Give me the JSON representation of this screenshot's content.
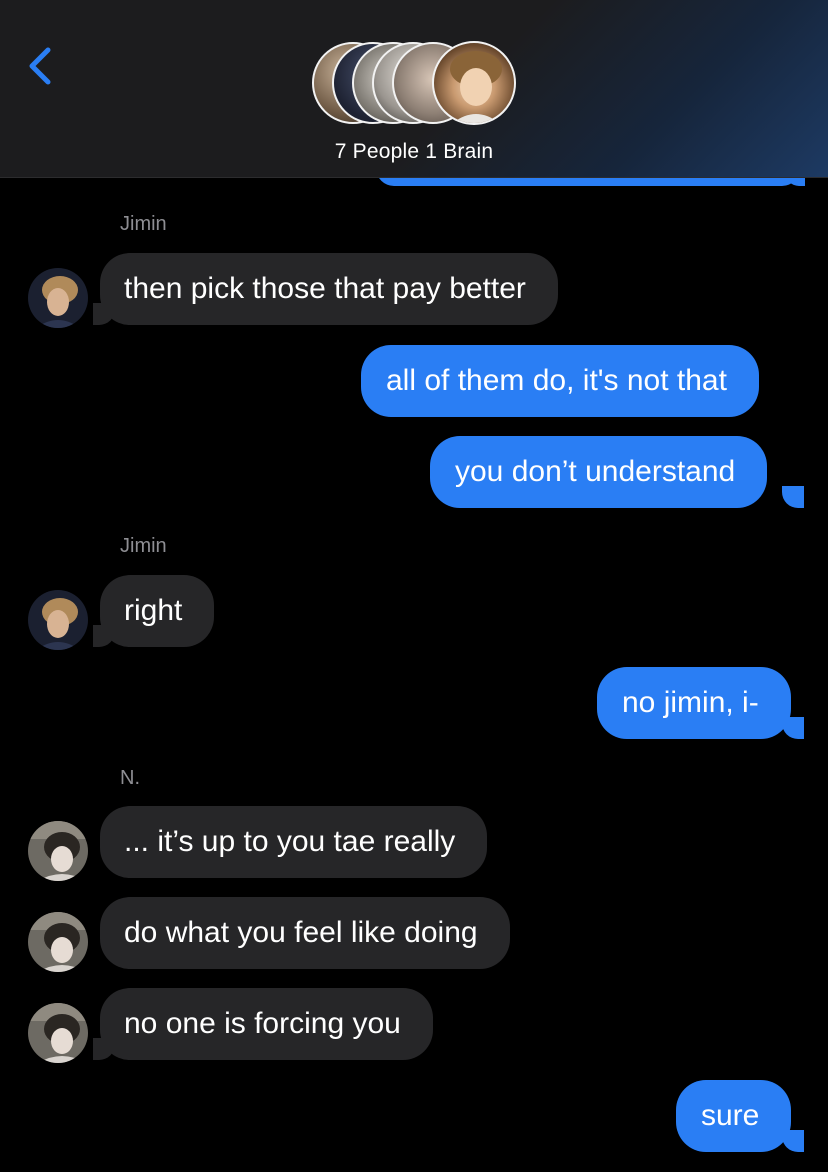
{
  "header": {
    "group_name": "7 People 1 Brain"
  },
  "messages": [
    {
      "sender": "Jimin",
      "text": "then pick those that pay better"
    },
    {
      "text": "all of them do, it's not that"
    },
    {
      "text": "you don’t understand"
    },
    {
      "sender": "Jimin",
      "text": "right"
    },
    {
      "text": "no jimin, i-"
    },
    {
      "sender": "N.",
      "text": "... it’s up to you tae really"
    },
    {
      "text": "do what you feel like doing"
    },
    {
      "text": "no one is forcing you"
    },
    {
      "text": "sure"
    }
  ],
  "colors": {
    "outgoing_bubble": "#2a7ef4",
    "incoming_bubble": "#262628",
    "back_chevron": "#2a7ef4",
    "sender_label": "#8e8e93"
  },
  "icons": {
    "back": "chevron-left-icon"
  }
}
